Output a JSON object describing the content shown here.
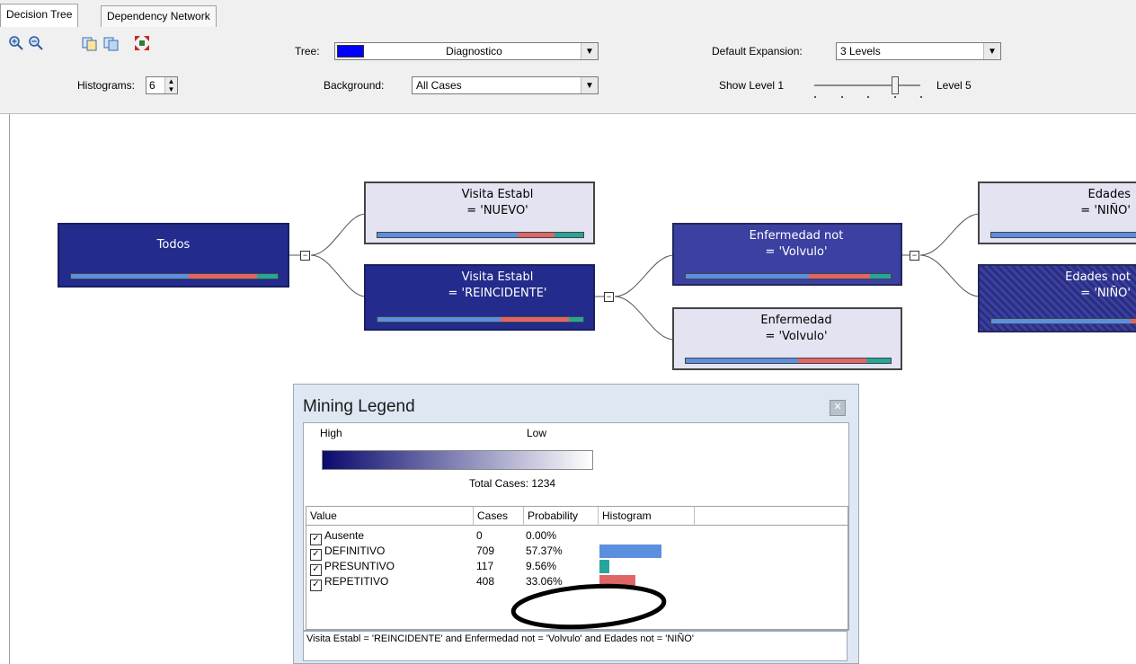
{
  "tabs": [
    {
      "label": "Decision Tree",
      "active": true
    },
    {
      "label": "Dependency Network",
      "active": false
    }
  ],
  "toolbar": {
    "histograms_label": "Histograms:",
    "histograms_value": "6",
    "tree_label": "Tree:",
    "tree_value": "Diagnostico",
    "tree_color": "#0000ff",
    "background_label": "Background:",
    "background_value": "All Cases",
    "default_expansion_label": "Default Expansion:",
    "default_expansion_value": "3 Levels",
    "show_level_label": "Show Level 1",
    "level_max_label": "Level 5",
    "show_level_value": 4,
    "icons": [
      "zoom-in-icon",
      "zoom-out-icon",
      "copy-graph-view-icon",
      "copy-entire-graph-icon",
      "size-to-fit-icon"
    ]
  },
  "tree": {
    "colors": {
      "definitivo": "#5b8fe0",
      "presuntivo": "#26a69a",
      "repetitivo": "#e06666",
      "dark_node": "#232b8c",
      "light_node": "#e4e3f1"
    },
    "nodes": [
      {
        "id": "todos",
        "line1": "Todos",
        "line2": "",
        "bar": [
          0.57,
          0.33,
          0.1
        ]
      },
      {
        "id": "nuevo",
        "line1": "Visita Establ",
        "line2": "= 'NUEVO'",
        "bar": [
          0.68,
          0.18,
          0.14
        ]
      },
      {
        "id": "reincidente",
        "line1": "Visita Establ",
        "line2": "= 'REINCIDENTE'",
        "bar": [
          0.6,
          0.33,
          0.07
        ]
      },
      {
        "id": "enf_not",
        "line1": "Enfermedad not",
        "line2": "= 'Volvulo'",
        "bar": [
          0.6,
          0.3,
          0.1
        ]
      },
      {
        "id": "enf",
        "line1": "Enfermedad",
        "line2": "= 'Volvulo'",
        "bar": [
          0.55,
          0.33,
          0.12
        ]
      },
      {
        "id": "edades",
        "line1": "Edades",
        "line2": "= 'NIÑO'",
        "bar": [
          1.0,
          0.0,
          0.0
        ]
      },
      {
        "id": "edades_not",
        "line1": "Edades not",
        "line2": "= 'NIÑO'",
        "bar": [
          0.85,
          0.15,
          0.0
        ]
      }
    ]
  },
  "legend": {
    "title": "Mining Legend",
    "high_label": "High",
    "low_label": "Low",
    "total_cases": "Total Cases: 1234",
    "columns": [
      "Value",
      "Cases",
      "Probability",
      "Histogram"
    ],
    "rows": [
      {
        "value": "Ausente",
        "cases": "0",
        "probability": "0.00%",
        "fraction": 0.0,
        "color": "#5b8fe0"
      },
      {
        "value": "DEFINITIVO",
        "cases": "709",
        "probability": "57.37%",
        "fraction": 0.5737,
        "color": "#5b8fe0"
      },
      {
        "value": "PRESUNTIVO",
        "cases": "117",
        "probability": "9.56%",
        "fraction": 0.0956,
        "color": "#26a69a"
      },
      {
        "value": "REPETITIVO",
        "cases": "408",
        "probability": "33.06%",
        "fraction": 0.3306,
        "color": "#e06666"
      }
    ],
    "footer": "Visita Establ = 'REINCIDENTE' and Enfermedad not = 'Volvulo' and Edades not = 'NIÑO'"
  }
}
